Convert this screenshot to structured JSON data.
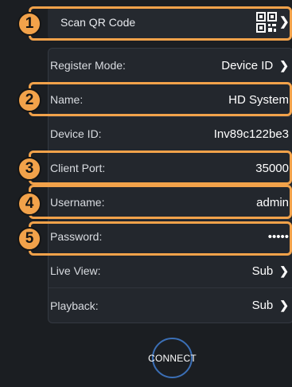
{
  "scan": {
    "label": "Scan QR Code"
  },
  "rows": [
    {
      "label": "Register Mode:",
      "value": "Device ID"
    },
    {
      "label": "Name:",
      "value": "HD System"
    },
    {
      "label": "Device ID:",
      "value": "Inv89c122be3"
    },
    {
      "label": "Client Port:",
      "value": "35000"
    },
    {
      "label": "Username:",
      "value": "admin"
    },
    {
      "label": "Password:",
      "value": "•••••"
    },
    {
      "label": "Live View:",
      "value": "Sub"
    },
    {
      "label": "Playback:",
      "value": "Sub"
    }
  ],
  "badges": [
    "1",
    "2",
    "3",
    "4",
    "5"
  ],
  "connect": {
    "label": "CONNECT"
  },
  "icons": {
    "qr": "qr-code-icon",
    "chevron": "chevron-right-icon"
  },
  "colors": {
    "highlight": "#f2a24a",
    "connect_ring": "#3b6fb6",
    "background": "#1b1e22"
  }
}
